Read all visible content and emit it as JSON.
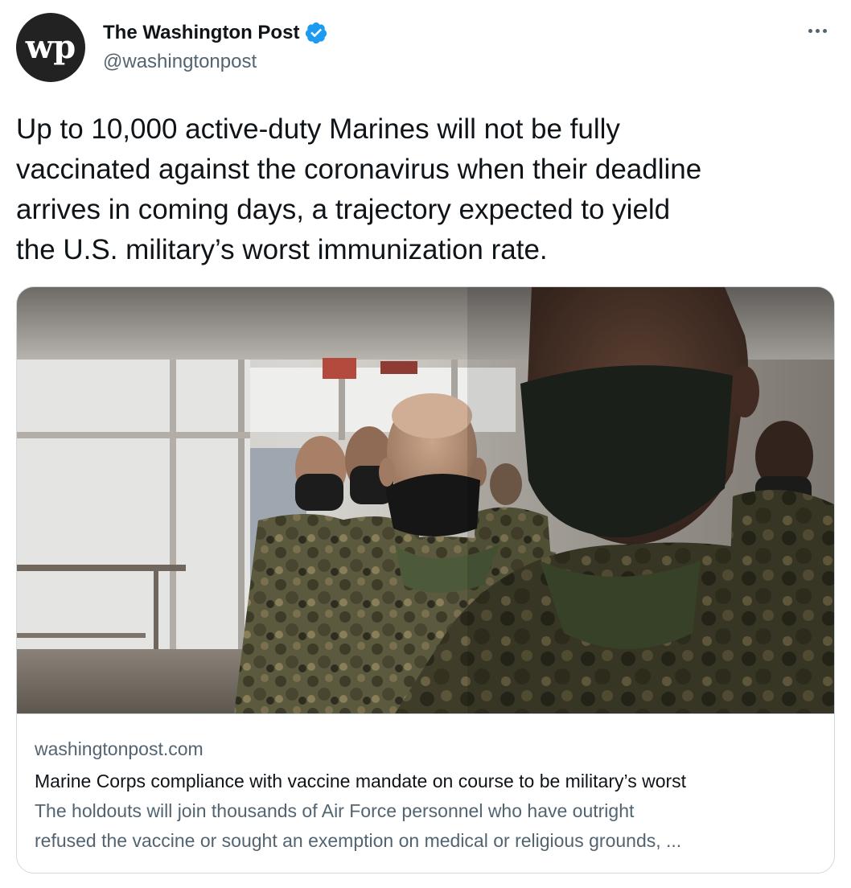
{
  "author": {
    "display_name": "The Washington Post",
    "handle": "@washingtonpost",
    "avatar_icon": "wp-logo-icon",
    "avatar_text": "wp",
    "verified": true,
    "verified_icon": "verified-badge-icon",
    "verified_color": "#1d9bf0"
  },
  "more_menu_icon": "more-horizontal-icon",
  "tweet": {
    "text": "Up to 10,000 active-duty Marines will not be fully\nvaccinated against the coronavirus when their deadline\narrives in coming days, a trajectory expected to yield\nthe U.S. military’s worst immunization rate."
  },
  "card": {
    "domain": "washingtonpost.com",
    "title": "Marine Corps compliance with vaccine mandate on course to be military’s worst",
    "description": "The holdouts will join thousands of Air Force personnel who have outright\nrefused the vaccine or sought an exemption on medical or religious grounds, ...",
    "image_subject": "Masked Marines in camouflage uniforms standing in line indoors"
  },
  "colors": {
    "text_primary": "#0f1419",
    "text_secondary": "#536471",
    "border": "#cfd9de"
  }
}
